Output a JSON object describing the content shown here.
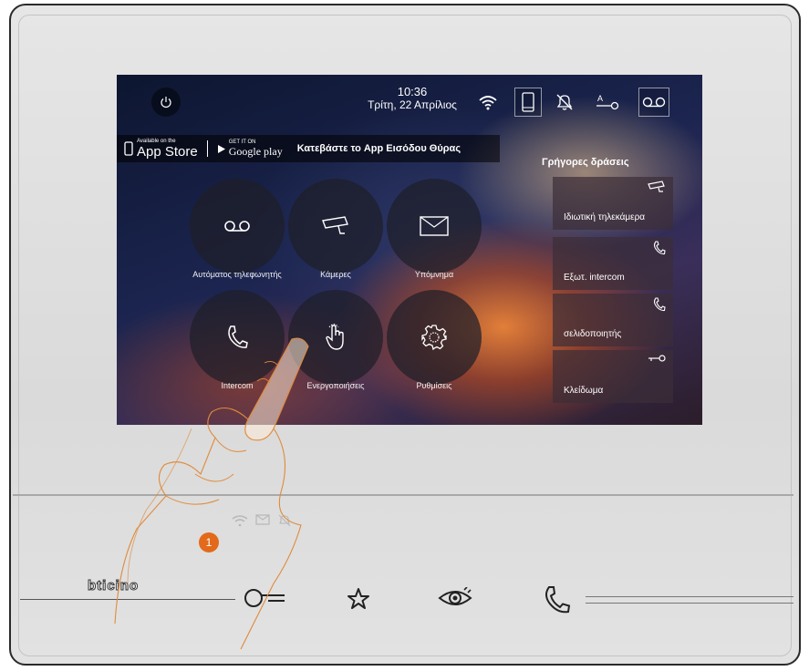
{
  "status": {
    "time": "10:36",
    "date": "Τρίτη, 22 Απρίλιος"
  },
  "appbar": {
    "appstore_small": "Available on the",
    "appstore": "App Store",
    "googleplay_small": "GET IT ON",
    "googleplay": "Google play",
    "message": "Κατεβάστε το App Εισόδου Θύρας"
  },
  "tiles": [
    {
      "label": "Αυτόματος τηλεφωνητής",
      "icon": "answering-machine-icon"
    },
    {
      "label": "Κάμερες",
      "icon": "camera-icon"
    },
    {
      "label": "Υπόμνημα",
      "icon": "envelope-icon"
    },
    {
      "label": "Intercom",
      "icon": "handset-icon"
    },
    {
      "label": "Ενεργοποιήσεις",
      "icon": "hand-pointer-icon"
    },
    {
      "label": "Ρυθμίσεις",
      "icon": "gear-icon"
    }
  ],
  "quick_actions": {
    "title": "Γρήγορες δράσεις",
    "items": [
      {
        "label": "Ιδιωτική τηλεκάμερα",
        "icon": "camera-icon"
      },
      {
        "label": "Εξωτ. intercom",
        "icon": "handset-icon"
      },
      {
        "label": "σελιδοποιητής",
        "icon": "handset-icon"
      },
      {
        "label": "Κλείδωμα",
        "icon": "key-icon"
      }
    ]
  },
  "device": {
    "brand": "bticino",
    "notification_number": "1"
  },
  "colors": {
    "accent": "#e26a1a"
  }
}
